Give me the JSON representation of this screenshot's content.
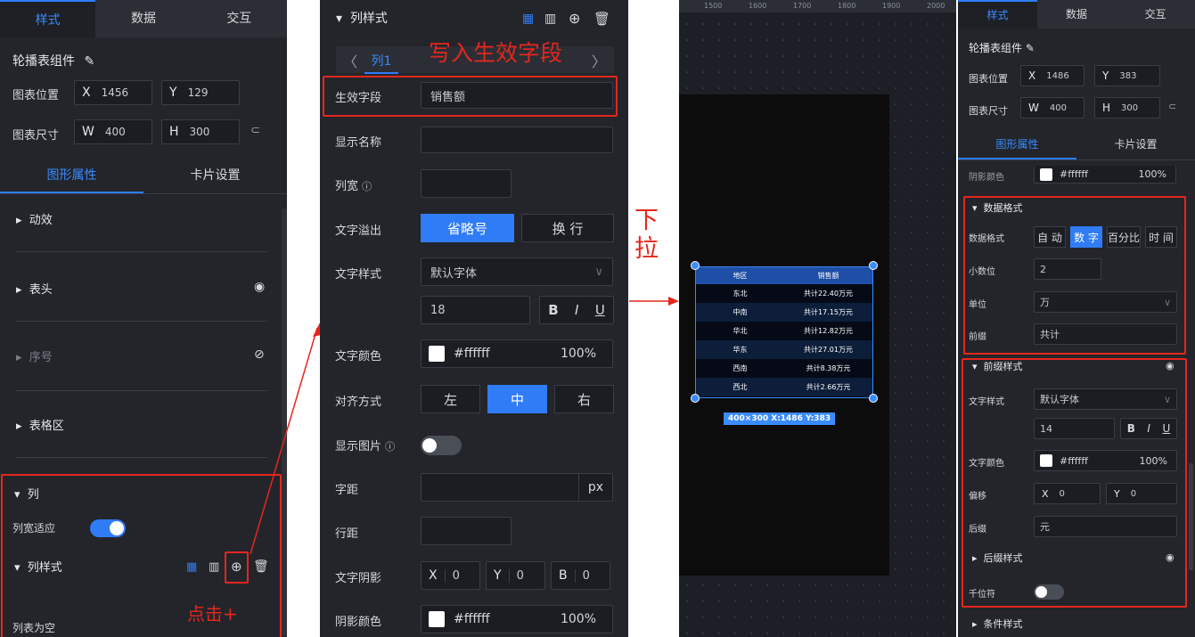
{
  "p1": {
    "tabs": [
      "样式",
      "数据",
      "交互"
    ],
    "component_name": "轮播表组件",
    "pos_label": "图表位置",
    "pos_x_prefix": "X",
    "pos_x": "1456",
    "pos_y_prefix": "Y",
    "pos_y": "129",
    "size_label": "图表尺寸",
    "size_w_prefix": "W",
    "size_w": "400",
    "size_h_prefix": "H",
    "size_h": "300",
    "subtabs": [
      "图形属性",
      "卡片设置"
    ],
    "sections": [
      "动效",
      "表头",
      "序号",
      "表格区"
    ],
    "col_section": "列",
    "col_fit_label": "列宽适应",
    "col_style": "列样式",
    "col_empty": "列表为空",
    "annot_click": "点击+"
  },
  "p2": {
    "header": "列样式",
    "col_tab": "列1",
    "annot_write": "写入生效字段",
    "field_label": "生效字段",
    "field_value": "销售额",
    "name_label": "显示名称",
    "width_label": "列宽",
    "overflow_label": "文字溢出",
    "overflow_opts": [
      "省略号",
      "换 行"
    ],
    "textstyle_label": "文字样式",
    "font_value": "默认字体",
    "font_size": "18",
    "bold": "B",
    "italic": "I",
    "underline": "U",
    "color_label": "文字颜色",
    "color_value": "#ffffff",
    "color_pct": "100%",
    "align_label": "对齐方式",
    "align_opts": [
      "左",
      "中",
      "右"
    ],
    "image_label": "显示图片",
    "spacing_label": "字距",
    "spacing_unit": "px",
    "lineh_label": "行距",
    "shadow_label": "文字阴影",
    "shadow_x_prefix": "X",
    "shadow_x": "0",
    "shadow_y_prefix": "Y",
    "shadow_y": "0",
    "shadow_b_prefix": "B",
    "shadow_b": "0",
    "shadowcolor_label": "阴影颜色",
    "shadowcolor_value": "#ffffff",
    "shadowcolor_pct": "100%"
  },
  "arrow": {
    "annot": [
      "下",
      "拉"
    ]
  },
  "canvas": {
    "ruler": [
      "1500",
      "1600",
      "1700",
      "1800",
      "1900",
      "2000"
    ],
    "table_header": [
      "地区",
      "销售额"
    ],
    "rows": [
      [
        "东北",
        "共计22.40万元"
      ],
      [
        "中南",
        "共计17.15万元"
      ],
      [
        "华北",
        "共计12.82万元"
      ],
      [
        "华东",
        "共计27.01万元"
      ],
      [
        "西南",
        "共计8.38万元"
      ],
      [
        "西北",
        "共计2.66万元"
      ]
    ],
    "size_tag": "400×300  X:1486 Y:383"
  },
  "p4": {
    "tabs": [
      "样式",
      "数据",
      "交互"
    ],
    "component_name": "轮播表组件",
    "pos_label": "图表位置",
    "pos_x_prefix": "X",
    "pos_x": "1486",
    "pos_y_prefix": "Y",
    "pos_y": "383",
    "size_label": "图表尺寸",
    "size_w_prefix": "W",
    "size_w": "400",
    "size_h_prefix": "H",
    "size_h": "300",
    "subtabs": [
      "图形属性",
      "卡片设置"
    ],
    "shadowcolor_label": "阴影颜色",
    "shadowcolor_value": "#ffffff",
    "shadowcolor_pct": "100%",
    "datafmt_section": "数据格式",
    "datafmt_label": "数据格式",
    "datafmt_opts": [
      "自 动",
      "数 字",
      "百分比",
      "时 间"
    ],
    "decimals_label": "小数位",
    "decimals_value": "2",
    "unit_label": "单位",
    "unit_value": "万",
    "prefix_label": "前缀",
    "prefix_value": "共计",
    "prefixstyle_section": "前缀样式",
    "textstyle_label": "文字样式",
    "font_value": "默认字体",
    "font_size": "14",
    "bold": "B",
    "italic": "I",
    "underline": "U",
    "color_label": "文字颜色",
    "color_value": "#ffffff",
    "color_pct": "100%",
    "offset_label": "偏移",
    "offset_x_prefix": "X",
    "offset_x": "0",
    "offset_y_prefix": "Y",
    "offset_y": "0",
    "suffix_label": "后缀",
    "suffix_value": "元",
    "suffixstyle_section": "后缀样式",
    "thousands_label": "千位符",
    "cond_section": "条件样式"
  },
  "colors": {
    "accent": "#2f7cf6",
    "annotation": "#e5261d"
  }
}
